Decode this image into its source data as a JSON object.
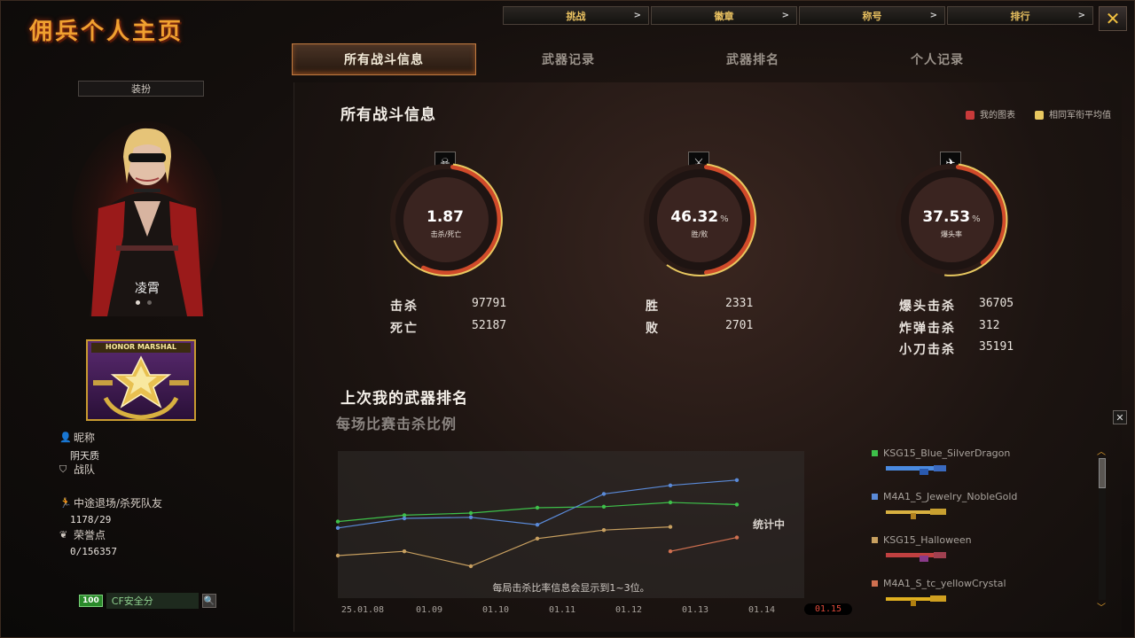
{
  "window": {
    "title": "佣兵个人主页",
    "close_glyph": "✕"
  },
  "topnav": [
    {
      "label": "挑战"
    },
    {
      "label": "徽章"
    },
    {
      "label": "称号"
    },
    {
      "label": "排行"
    }
  ],
  "tabs": [
    {
      "label": "所有战斗信息",
      "active": true
    },
    {
      "label": "武器记录",
      "active": false
    },
    {
      "label": "武器排名",
      "active": false
    },
    {
      "label": "个人记录",
      "active": false
    }
  ],
  "left": {
    "outfit_label": "装扮",
    "char_name": "凌霄",
    "rank_badge_text": "HONOR MARSHAL",
    "nickname_label": "昵称",
    "nickname_value": "阴天质",
    "team_label": "战队",
    "quit_label": "中途退场/杀死队友",
    "quit_value": "1178/29",
    "honor_label": "荣誉点",
    "honor_value": "0/156357",
    "safety_score": "100",
    "safety_label": "CF安全分"
  },
  "main": {
    "section_title": "所有战斗信息",
    "legend": [
      {
        "label": "我的图表",
        "color": "#c83a3a"
      },
      {
        "label": "相同军衔平均值",
        "color": "#e8c860"
      }
    ],
    "gauges": [
      {
        "icon": "skull-icon",
        "glyph": "☠",
        "value": "1.87",
        "pct": "",
        "label": "击杀/死亡",
        "fill": 0.55
      },
      {
        "icon": "swords-icon",
        "glyph": "⚔",
        "value": "46.32",
        "pct": "%",
        "label": "胜/败",
        "fill": 0.46
      },
      {
        "icon": "rifle-icon",
        "glyph": "✈",
        "value": "37.53",
        "pct": "%",
        "label": "爆头率",
        "fill": 0.38
      }
    ],
    "stats": {
      "kills_label": "击杀",
      "kills": "97791",
      "deaths_label": "死亡",
      "deaths": "52187",
      "wins_label": "胜",
      "wins": "2331",
      "losses_label": "败",
      "losses": "2701",
      "headshot_label": "爆头击杀",
      "headshot": "36705",
      "bomb_label": "炸弹击杀",
      "bomb": "312",
      "knife_label": "小刀击杀",
      "knife": "35191"
    },
    "weapon_rank_title": "上次我的武器排名"
  },
  "chart_panel": {
    "subtitle": "每场比赛击杀比例",
    "status": "统计中",
    "note": "每局击杀比率信息会显示到1~3位。",
    "close_glyph": "✕",
    "selected_date": "01.15"
  },
  "chart_data": {
    "type": "line",
    "x": [
      "25.01.08",
      "01.09",
      "01.10",
      "01.11",
      "01.12",
      "01.13",
      "01.14",
      "01.15"
    ],
    "series": [
      {
        "name": "KSG15_Blue_SilverDragon",
        "color": "#3ec04a",
        "values": [
          0.52,
          0.58,
          0.6,
          0.65,
          0.66,
          0.7,
          0.68,
          null
        ]
      },
      {
        "name": "M4A1_S_Jewelry_NobleGold",
        "color": "#5a8ad8",
        "values": [
          0.46,
          0.55,
          0.56,
          0.49,
          0.78,
          0.86,
          0.91,
          null
        ]
      },
      {
        "name": "KSG15_Halloween",
        "color": "#c8a060",
        "values": [
          0.2,
          0.24,
          0.1,
          0.36,
          0.44,
          0.47,
          null,
          null
        ]
      },
      {
        "name": "M4A1_S_tc_yellowCrystal",
        "color": "#d07050",
        "values": [
          null,
          null,
          null,
          null,
          null,
          0.24,
          0.37,
          null
        ]
      }
    ],
    "ylim": [
      0,
      1
    ]
  },
  "weapons": [
    {
      "name": "KSG15_Blue_SilverDragon",
      "color": "#3ec04a",
      "gun_color": "#4a8ae0"
    },
    {
      "name": "M4A1_S_Jewelry_NobleGold",
      "color": "#5a8ad8",
      "gun_color": "#d8b040"
    },
    {
      "name": "KSG15_Halloween",
      "color": "#c8a060",
      "gun_color": "#c04040"
    },
    {
      "name": "M4A1_S_tc_yellowCrystal",
      "color": "#d07050",
      "gun_color": "#e0b020"
    }
  ]
}
